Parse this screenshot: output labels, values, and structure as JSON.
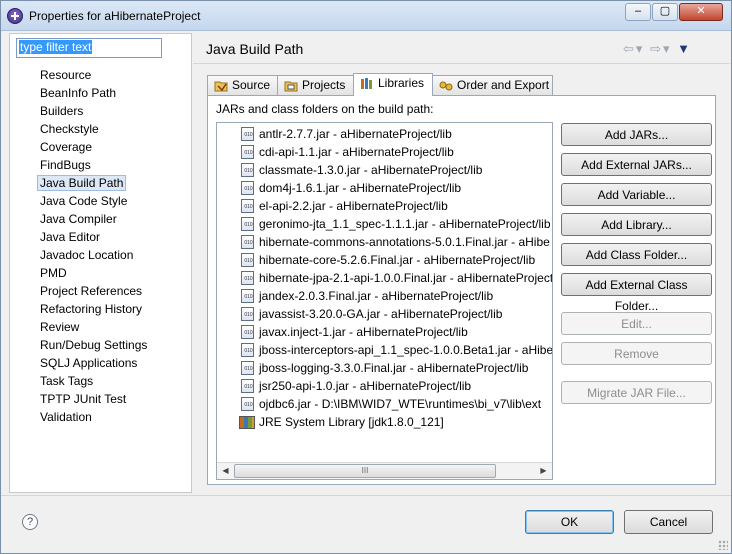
{
  "window": {
    "title": "Properties for aHibernateProject",
    "controls": {
      "minimize": "–",
      "maximize": "▢",
      "close": "✕"
    }
  },
  "filter": {
    "value": "type filter text"
  },
  "nav": {
    "items": [
      "Resource",
      "BeanInfo Path",
      "Builders",
      "Checkstyle",
      "Coverage",
      "FindBugs",
      "Java Build Path",
      "Java Code Style",
      "Java Compiler",
      "Java Editor",
      "Javadoc Location",
      "PMD",
      "Project References",
      "Refactoring History",
      "Review",
      "Run/Debug Settings",
      "SQLJ Applications",
      "Task Tags",
      "TPTP JUnit Test",
      "Validation"
    ],
    "selected": "Java Build Path"
  },
  "page": {
    "title": "Java Build Path",
    "history": {
      "back": "⇦",
      "back_menu": "▾",
      "forward": "⇨",
      "forward_menu": "▾",
      "view_menu": "▼"
    }
  },
  "tabs": [
    {
      "label": "Source",
      "icon": "source-folder-icon"
    },
    {
      "label": "Projects",
      "icon": "projects-icon"
    },
    {
      "label": "Libraries",
      "icon": "libraries-icon",
      "active": true
    },
    {
      "label": "Order and Export",
      "icon": "order-export-icon"
    }
  ],
  "libraries": {
    "caption": "JARs and class folders on the build path:",
    "entries": [
      "antlr-2.7.7.jar - aHibernateProject/lib",
      "cdi-api-1.1.jar - aHibernateProject/lib",
      "classmate-1.3.0.jar - aHibernateProject/lib",
      "dom4j-1.6.1.jar - aHibernateProject/lib",
      "el-api-2.2.jar - aHibernateProject/lib",
      "geronimo-jta_1.1_spec-1.1.1.jar - aHibernateProject/lib",
      "hibernate-commons-annotations-5.0.1.Final.jar - aHibe",
      "hibernate-core-5.2.6.Final.jar - aHibernateProject/lib",
      "hibernate-jpa-2.1-api-1.0.0.Final.jar - aHibernateProject",
      "jandex-2.0.3.Final.jar - aHibernateProject/lib",
      "javassist-3.20.0-GA.jar - aHibernateProject/lib",
      "javax.inject-1.jar - aHibernateProject/lib",
      "jboss-interceptors-api_1.1_spec-1.0.0.Beta1.jar - aHibern",
      "jboss-logging-3.3.0.Final.jar - aHibernateProject/lib",
      "jsr250-api-1.0.jar - aHibernateProject/lib",
      "ojdbc6.jar - D:\\IBM\\WID7_WTE\\runtimes\\bi_v7\\lib\\ext"
    ],
    "system_library": "JRE System Library [jdk1.8.0_121]",
    "scroll": {
      "left": "◀",
      "right": "▶",
      "thumb": "III"
    }
  },
  "buttons": {
    "add_jars": "Add JARs...",
    "add_external_jars": "Add External JARs...",
    "add_variable": "Add Variable...",
    "add_library": "Add Library...",
    "add_class_folder": "Add Class Folder...",
    "add_external_class_folder": "Add External Class Folder...",
    "edit": "Edit...",
    "remove": "Remove",
    "migrate_jar": "Migrate JAR File..."
  },
  "footer": {
    "help": "?",
    "ok": "OK",
    "cancel": "Cancel"
  }
}
